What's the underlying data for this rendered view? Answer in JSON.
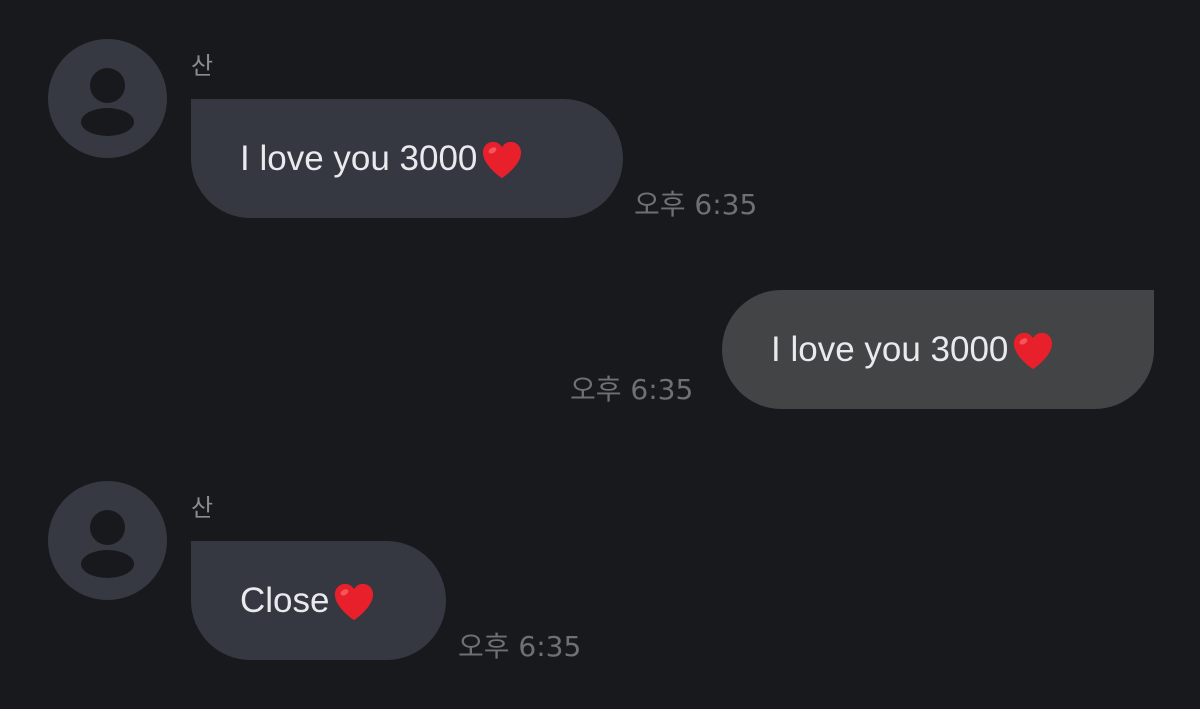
{
  "chat": {
    "messages": [
      {
        "direction": "incoming",
        "sender": "산",
        "text": "I love you 3000",
        "emoji": "red-heart",
        "time": "오후 6:35"
      },
      {
        "direction": "outgoing",
        "text": "I love you 3000",
        "emoji": "red-heart",
        "time": "오후 6:35"
      },
      {
        "direction": "incoming",
        "sender": "산",
        "text": "Close",
        "emoji": "red-heart",
        "time": "오후 6:35"
      }
    ]
  },
  "colors": {
    "background": "#18191d",
    "incoming_bubble": "#353841",
    "outgoing_bubble": "#434445",
    "avatar": "#363941",
    "heart": "#e8202b",
    "text": "#e9eaed",
    "timestamp": "#6e7076",
    "sender_name": "#8a8d93"
  }
}
